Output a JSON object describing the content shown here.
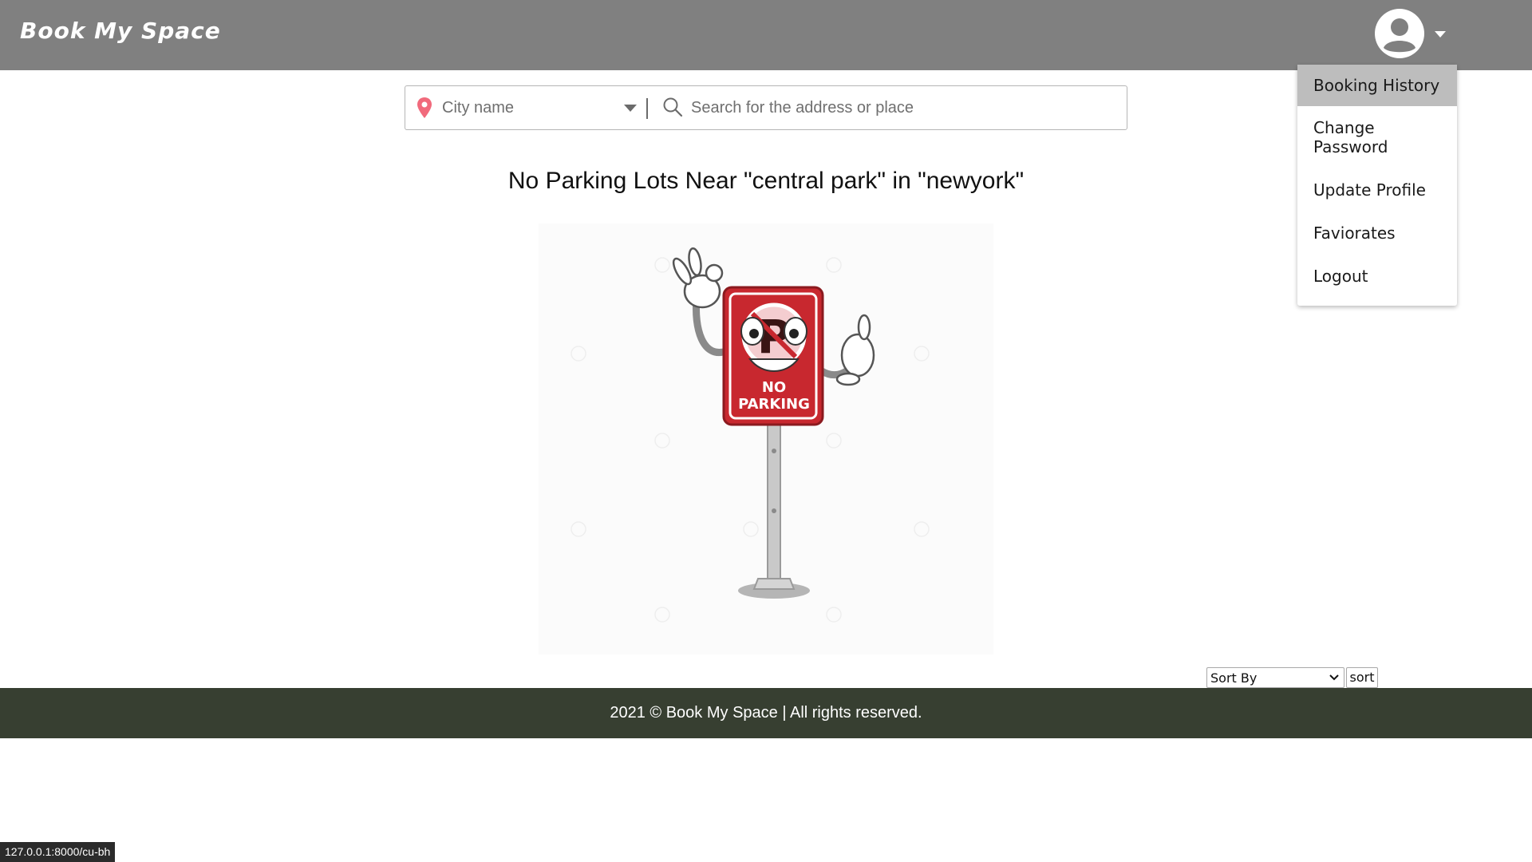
{
  "header": {
    "brand": "Book My Space",
    "user_menu": {
      "items": [
        {
          "label": "Booking History",
          "active": true
        },
        {
          "label": "Change Password",
          "active": false
        },
        {
          "label": "Update Profile",
          "active": false
        },
        {
          "label": "Faviorates",
          "active": false
        },
        {
          "label": "Logout",
          "active": false
        }
      ]
    }
  },
  "search": {
    "city_placeholder": "City name",
    "place_placeholder": "Search for the address or place"
  },
  "results": {
    "message": "No Parking Lots Near \"central park\" in \"newyork\"",
    "illustration_text_line1": "NO",
    "illustration_text_line2": "PARKING"
  },
  "sort": {
    "select_label": "Sort By",
    "button_label": "sort"
  },
  "footer": {
    "text": "2021 © Book My Space | All rights reserved."
  },
  "status_bar": {
    "url": "127.0.0.1:8000/cu-bh"
  },
  "colors": {
    "navbar": "#808080",
    "footer": "#373f31",
    "sign_red": "#c8282f",
    "pin": "#f16a7c"
  }
}
